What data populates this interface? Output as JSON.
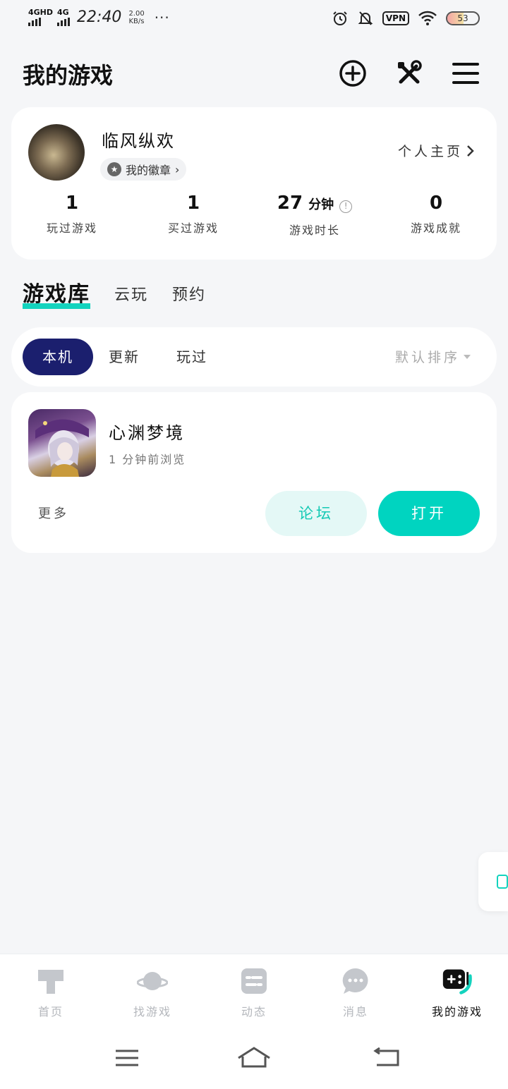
{
  "status_bar": {
    "signal_1": "4GHD",
    "signal_2": "4G",
    "time": "22:40",
    "speed_value": "2.00",
    "speed_unit": "KB/s",
    "more": "···",
    "vpn": "VPN",
    "battery": "53"
  },
  "header": {
    "title": "我的游戏"
  },
  "profile": {
    "name": "临风纵欢",
    "badge_label": "我的徽章",
    "homepage_label": "个人主页",
    "stats": [
      {
        "value": "1",
        "unit": "",
        "label": "玩过游戏"
      },
      {
        "value": "1",
        "unit": "",
        "label": "买过游戏"
      },
      {
        "value": "27",
        "unit": "分钟",
        "label": "游戏时长"
      },
      {
        "value": "0",
        "unit": "",
        "label": "游戏成就"
      }
    ]
  },
  "tabs": [
    {
      "label": "游戏库",
      "active": true
    },
    {
      "label": "云玩",
      "active": false
    },
    {
      "label": "预约",
      "active": false
    }
  ],
  "filters": {
    "chips": [
      {
        "label": "本机",
        "active": true
      },
      {
        "label": "更新",
        "active": false
      },
      {
        "label": "玩过",
        "active": false
      }
    ],
    "sort_label": "默认排序"
  },
  "game": {
    "name": "心渊梦境",
    "subtitle": "1 分钟前浏览",
    "more_label": "更多",
    "forum_label": "论坛",
    "open_label": "打开"
  },
  "bottom_nav": [
    {
      "label": "首页",
      "icon": "home-icon",
      "active": false
    },
    {
      "label": "找游戏",
      "icon": "planet-icon",
      "active": false
    },
    {
      "label": "动态",
      "icon": "feed-icon",
      "active": false
    },
    {
      "label": "消息",
      "icon": "message-icon",
      "active": false
    },
    {
      "label": "我的游戏",
      "icon": "gamepad-icon",
      "active": true
    }
  ],
  "colors": {
    "accent": "#13d3be",
    "chip_active": "#1b1f6e",
    "open_button": "#00d4c0",
    "background": "#f5f6f8"
  }
}
